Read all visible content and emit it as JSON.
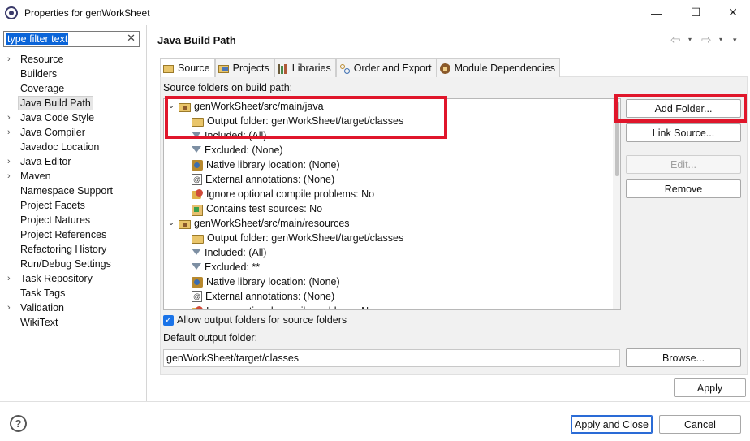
{
  "window": {
    "title": "Properties for genWorkSheet",
    "minimize": "—",
    "maximize": "☐",
    "close": "✕"
  },
  "filter": {
    "value": "type filter text",
    "clear": "✕"
  },
  "nav": {
    "items": [
      {
        "label": "Resource",
        "expandable": true
      },
      {
        "label": "Builders",
        "expandable": false
      },
      {
        "label": "Coverage",
        "expandable": false
      },
      {
        "label": "Java Build Path",
        "expandable": false,
        "selected": true
      },
      {
        "label": "Java Code Style",
        "expandable": true
      },
      {
        "label": "Java Compiler",
        "expandable": true
      },
      {
        "label": "Javadoc Location",
        "expandable": false
      },
      {
        "label": "Java Editor",
        "expandable": true
      },
      {
        "label": "Maven",
        "expandable": true
      },
      {
        "label": "Namespace Support",
        "expandable": false
      },
      {
        "label": "Project Facets",
        "expandable": false
      },
      {
        "label": "Project Natures",
        "expandable": false
      },
      {
        "label": "Project References",
        "expandable": false
      },
      {
        "label": "Refactoring History",
        "expandable": false
      },
      {
        "label": "Run/Debug Settings",
        "expandable": false
      },
      {
        "label": "Task Repository",
        "expandable": true
      },
      {
        "label": "Task Tags",
        "expandable": false
      },
      {
        "label": "Validation",
        "expandable": true
      },
      {
        "label": "WikiText",
        "expandable": false
      }
    ]
  },
  "page": {
    "title": "Java Build Path",
    "back_icon": "⇦",
    "forward_icon": "⇨",
    "dropdown_icon": "▾"
  },
  "tabs": [
    {
      "label": "Source",
      "icon": "source-folder-icon",
      "active": true
    },
    {
      "label": "Projects",
      "icon": "projects-icon"
    },
    {
      "label": "Libraries",
      "icon": "libraries-icon"
    },
    {
      "label": "Order and Export",
      "icon": "order-export-icon"
    },
    {
      "label": "Module Dependencies",
      "icon": "module-icon"
    }
  ],
  "source": {
    "label": "Source folders on build path:",
    "tree": [
      {
        "level": 0,
        "icon": "package-folder-icon",
        "text": "genWorkSheet/src/main/java",
        "expanded": true
      },
      {
        "level": 1,
        "icon": "folder-icon",
        "text": "Output folder: genWorkSheet/target/classes"
      },
      {
        "level": 1,
        "icon": "filter-icon",
        "text": "Included: (All)"
      },
      {
        "level": 1,
        "icon": "filter-icon",
        "text": "Excluded: (None)"
      },
      {
        "level": 1,
        "icon": "native-library-icon",
        "text": "Native library location: (None)"
      },
      {
        "level": 1,
        "icon": "external-annotations-icon",
        "text": "External annotations: (None)"
      },
      {
        "level": 1,
        "icon": "ignore-problems-icon",
        "text": "Ignore optional compile problems: No"
      },
      {
        "level": 1,
        "icon": "test-sources-icon",
        "text": "Contains test sources: No"
      },
      {
        "level": 0,
        "icon": "package-folder-icon",
        "text": "genWorkSheet/src/main/resources",
        "expanded": true
      },
      {
        "level": 1,
        "icon": "folder-icon",
        "text": "Output folder: genWorkSheet/target/classes"
      },
      {
        "level": 1,
        "icon": "filter-icon",
        "text": "Included: (All)"
      },
      {
        "level": 1,
        "icon": "filter-icon",
        "text": "Excluded: **"
      },
      {
        "level": 1,
        "icon": "native-library-icon",
        "text": "Native library location: (None)"
      },
      {
        "level": 1,
        "icon": "external-annotations-icon",
        "text": "External annotations: (None)"
      },
      {
        "level": 1,
        "icon": "ignore-problems-icon",
        "text": "Ignore optional compile problems: No"
      }
    ]
  },
  "buttons": {
    "add_folder": "Add Folder...",
    "link_source": "Link Source...",
    "edit": "Edit...",
    "remove": "Remove",
    "browse": "Browse...",
    "apply": "Apply",
    "apply_and_close": "Apply and Close",
    "cancel": "Cancel"
  },
  "options": {
    "allow_output_label": "Allow output folders for source folders",
    "allow_output_checked": true,
    "default_output_label": "Default output folder:",
    "default_output_value": "genWorkSheet/target/classes"
  },
  "help": "?",
  "colors": {
    "highlight": "#e0162b",
    "selection": "#0a64d8"
  }
}
